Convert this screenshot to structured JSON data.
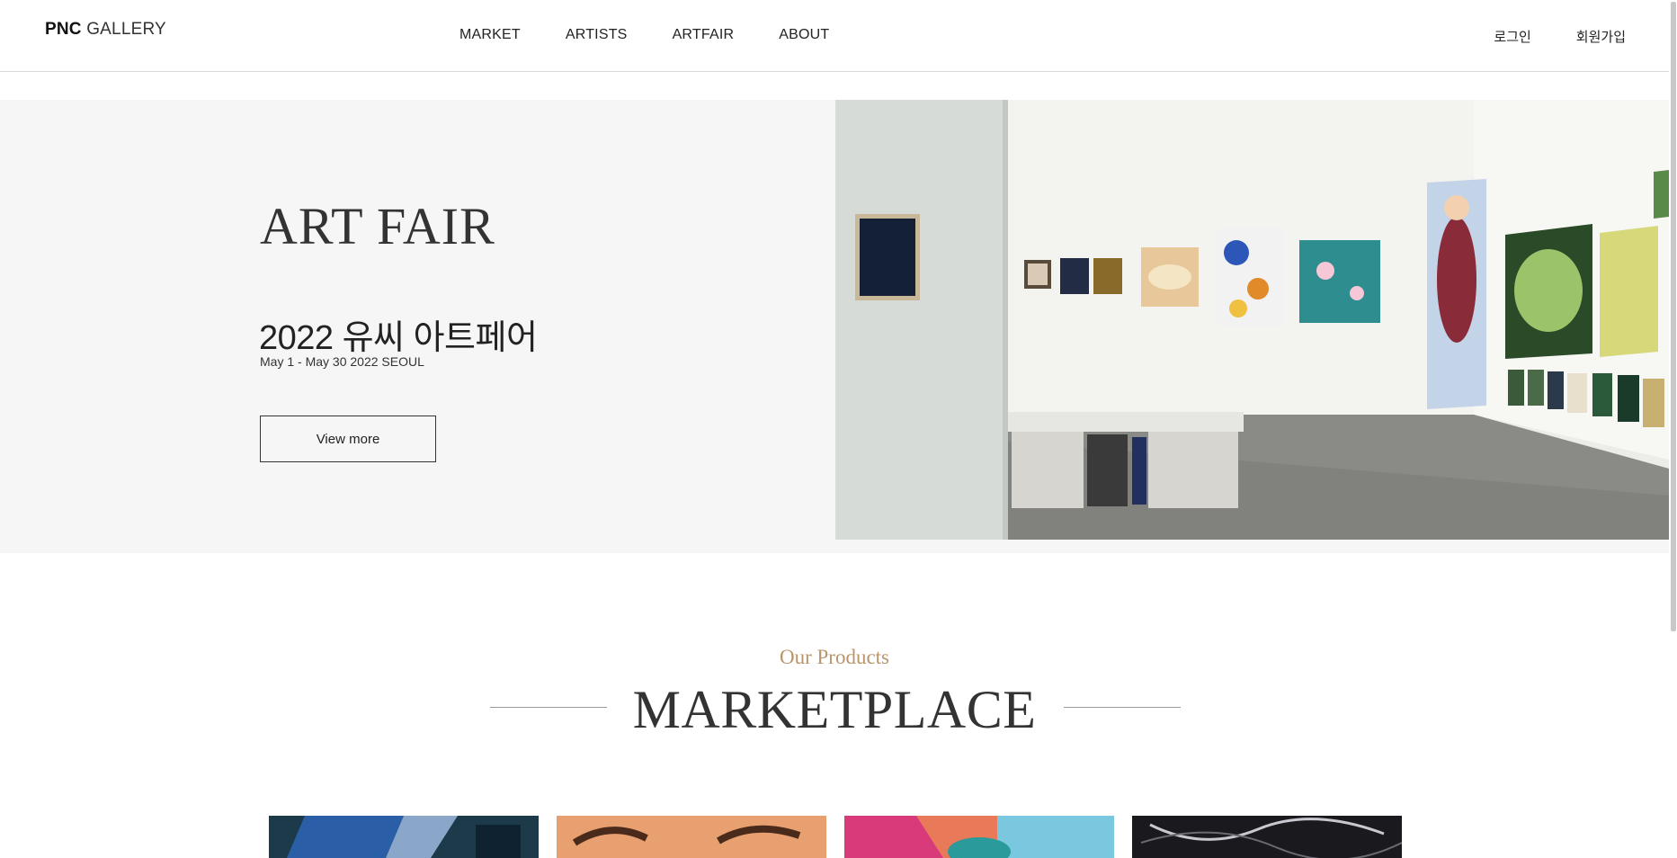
{
  "header": {
    "logo_bold": "PNC",
    "logo_light": "GALLERY",
    "nav": [
      "MARKET",
      "ARTISTS",
      "ARTFAIR",
      "ABOUT"
    ],
    "auth": {
      "login": "로그인",
      "signup": "회원가입"
    }
  },
  "hero": {
    "title": "ART FAIR",
    "subtitle": "2022 유씨 아트페어",
    "date": "May 1 - May 30 2022 SEOUL",
    "button_label": "View more"
  },
  "marketplace": {
    "eyebrow": "Our Products",
    "title": "MARKETPLACE"
  },
  "colors": {
    "accent": "#b8956a",
    "hero_bg": "#f6f6f6",
    "text": "#333333"
  }
}
